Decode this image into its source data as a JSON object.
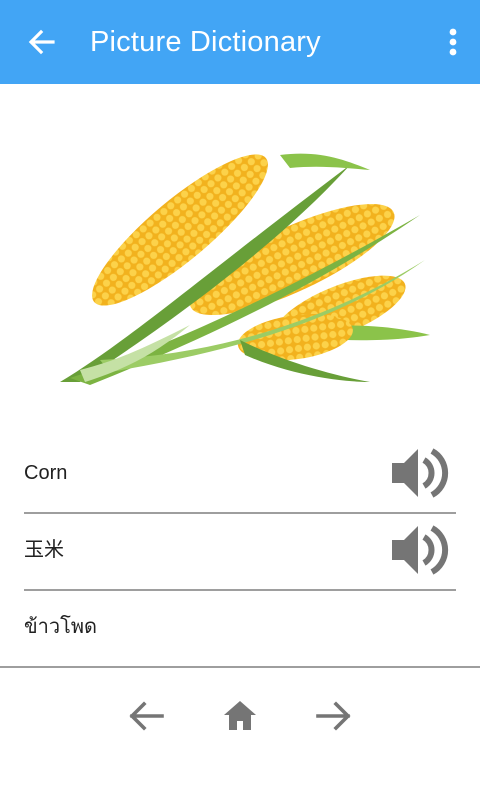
{
  "app_bar": {
    "title": "Picture Dictionary",
    "back_icon": "arrow-left-icon",
    "menu_icon": "more-vertical-icon"
  },
  "picture": {
    "icon": "corn-image"
  },
  "entries": [
    {
      "word": "Corn",
      "audio_icon": "speaker-icon"
    },
    {
      "word": "玉米",
      "audio_icon": "speaker-icon"
    },
    {
      "word": "ข้าวโพด"
    }
  ],
  "footer_nav": {
    "previous_icon": "arrow-left-icon",
    "home_icon": "home-icon",
    "next_icon": "arrow-right-icon"
  },
  "colors": {
    "app_bar": "#42a5f5",
    "divider": "#9e9e9e",
    "icon_gray": "#757575",
    "corn_kernel": "#f9c22e",
    "husk_green": "#7cb342"
  }
}
